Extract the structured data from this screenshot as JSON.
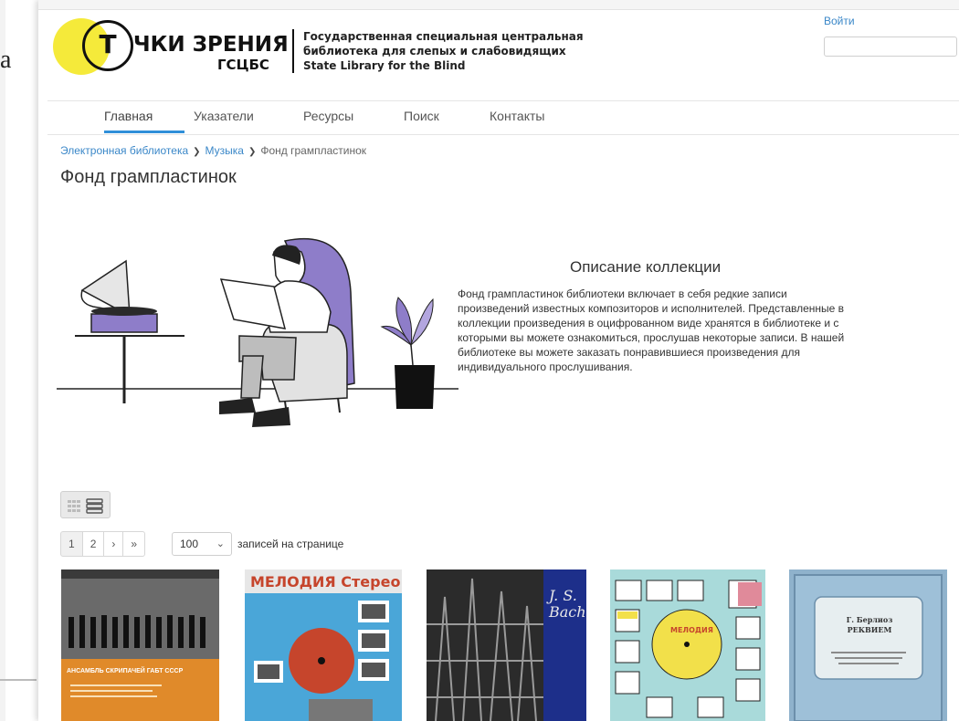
{
  "logo": {
    "main": "ЧКИ ЗРЕНИЯ",
    "ring_letter": "Т",
    "sub": "ГСЦБС",
    "line1": "Государственная специальная центральная",
    "line2": "библиотека для слепых и слабовидящих",
    "line3": "State Library for the Blind"
  },
  "header": {
    "login": "Войти",
    "search_value": ""
  },
  "nav": [
    "Главная",
    "Указатели",
    "Ресурсы",
    "Поиск",
    "Контакты"
  ],
  "breadcrumb": {
    "item1": "Электронная библиотека",
    "item2": "Музыка",
    "current": "Фонд грампластинок"
  },
  "page_title": "Фонд грампластинок",
  "description": {
    "title": "Описание коллекции",
    "text": "Фонд грампластинок библиотеки включает в себя редкие записи произведений известных композиторов и исполнителей. Представленные в коллекции произведения в оцифрованном виде хранятся в библиотеке и с которыми вы можете ознакомиться, прослушав некоторые записи. В нашей библиотеке вы можете заказать понравившиеся произведения для индивидуального прослушивания."
  },
  "pagination": {
    "pages": [
      "1",
      "2"
    ],
    "next": "›",
    "last": "»"
  },
  "per_page": {
    "value": "100",
    "label": "записей на странице"
  },
  "covers": [
    {
      "text": "АНСАМБЛЬ СКРИПАЧЕЙ ГАБТ СССР",
      "bg": "#3a3a3a",
      "accent": "#e08a2a"
    },
    {
      "text": "МЕЛОДИЯ Стерео",
      "bg": "#4aa6d8",
      "accent": "#c6452c"
    },
    {
      "text": "J. S. Bach",
      "bg": "#2b2b2b",
      "accent": "#1d2f8a"
    },
    {
      "text": "МЕЛОДИЯ",
      "bg": "#a9dada",
      "accent": "#f2e04a"
    },
    {
      "text": "Г. Берлиоз РЕКВИЕМ",
      "bg": "#8fb2cc",
      "accent": "#e7eef0"
    }
  ]
}
